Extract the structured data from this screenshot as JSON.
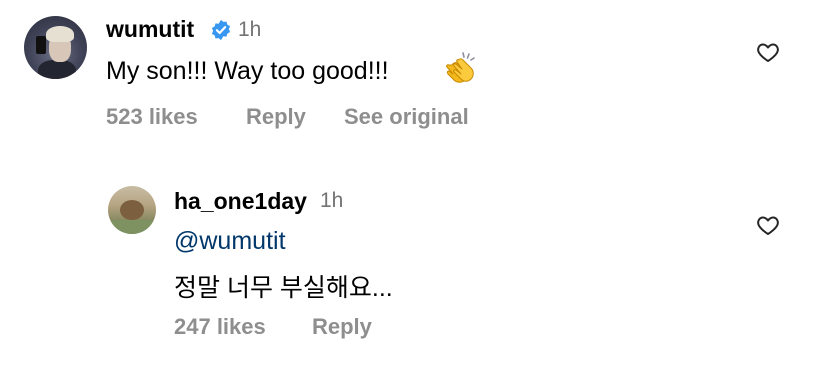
{
  "comment": {
    "username": "wumutit",
    "time": "1h",
    "text": "My son!!! Way too good!!!",
    "emoji": "clapping-hands",
    "likes": "523 likes",
    "reply_label": "Reply",
    "see_original_label": "See original"
  },
  "reply": {
    "username": "ha_one1day",
    "time": "1h",
    "mention": "@wumutit",
    "text": "정말 너무 부실해요...",
    "likes": "247 likes",
    "reply_label": "Reply"
  },
  "colors": {
    "username": "#000000",
    "secondary": "#8e8e8e",
    "mention": "#00376b",
    "verified": "#3897f0"
  }
}
